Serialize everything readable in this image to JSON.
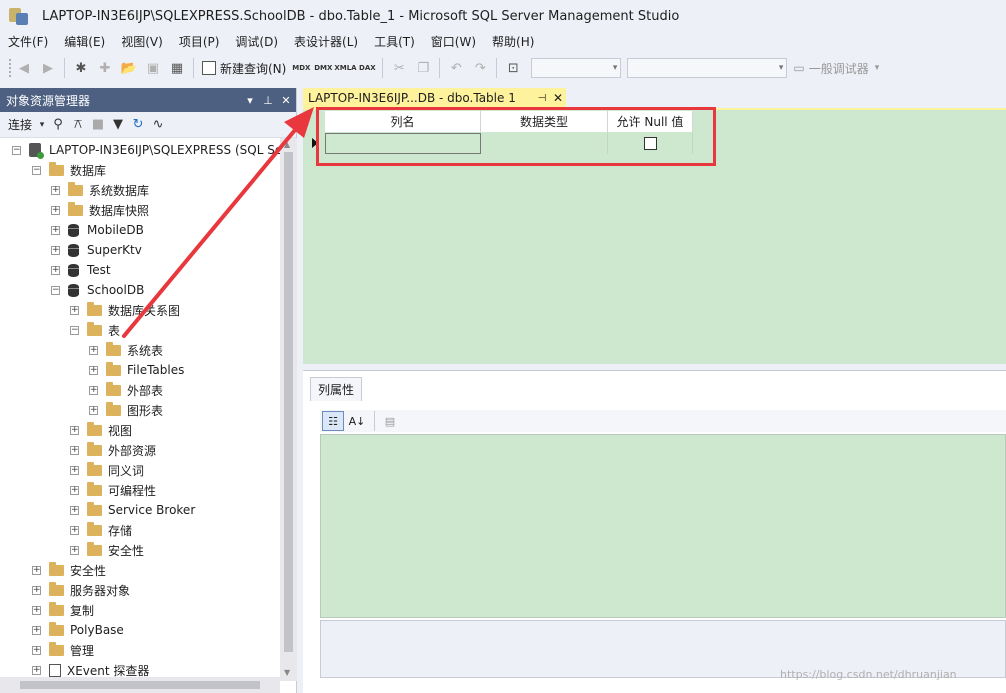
{
  "window": {
    "title": "LAPTOP-IN3E6IJP\\SQLEXPRESS.SchoolDB - dbo.Table_1 - Microsoft SQL Server Management Studio"
  },
  "menu": [
    "文件(F)",
    "编辑(E)",
    "视图(V)",
    "项目(P)",
    "调试(D)",
    "表设计器(L)",
    "工具(T)",
    "窗口(W)",
    "帮助(H)"
  ],
  "toolbar": {
    "new_query": "新建查询(N)",
    "mdx": "MDX",
    "dmx": "DMX",
    "xmla": "XMLA",
    "dax": "DAX",
    "debugger": "一般调试器"
  },
  "object_explorer": {
    "title": "对象资源管理器",
    "connect": "连接",
    "tree": [
      {
        "label": "LAPTOP-IN3E6IJP\\SQLEXPRESS (SQL Se",
        "icon": "server",
        "expander": "−"
      },
      {
        "label": "数据库",
        "icon": "folder",
        "expander": "−"
      },
      {
        "label": "系统数据库",
        "icon": "folder",
        "expander": "+"
      },
      {
        "label": "数据库快照",
        "icon": "folder",
        "expander": "+"
      },
      {
        "label": "MobileDB",
        "icon": "db",
        "expander": "+"
      },
      {
        "label": "SuperKtv",
        "icon": "db",
        "expander": "+"
      },
      {
        "label": "Test",
        "icon": "db",
        "expander": "+"
      },
      {
        "label": "SchoolDB",
        "icon": "db",
        "expander": "−"
      },
      {
        "label": "数据库关系图",
        "icon": "folder",
        "expander": "+"
      },
      {
        "label": "表",
        "icon": "folder",
        "expander": "−"
      },
      {
        "label": "系统表",
        "icon": "folder",
        "expander": "+"
      },
      {
        "label": "FileTables",
        "icon": "folder",
        "expander": "+"
      },
      {
        "label": "外部表",
        "icon": "folder",
        "expander": "+"
      },
      {
        "label": "图形表",
        "icon": "folder",
        "expander": "+"
      },
      {
        "label": "视图",
        "icon": "folder",
        "expander": "+"
      },
      {
        "label": "外部资源",
        "icon": "folder",
        "expander": "+"
      },
      {
        "label": "同义词",
        "icon": "folder",
        "expander": "+"
      },
      {
        "label": "可编程性",
        "icon": "folder",
        "expander": "+"
      },
      {
        "label": "Service Broker",
        "icon": "folder",
        "expander": "+"
      },
      {
        "label": "存储",
        "icon": "folder",
        "expander": "+"
      },
      {
        "label": "安全性",
        "icon": "folder",
        "expander": "+"
      },
      {
        "label": "安全性",
        "icon": "folder",
        "expander": "+"
      },
      {
        "label": "服务器对象",
        "icon": "folder",
        "expander": "+"
      },
      {
        "label": "复制",
        "icon": "folder",
        "expander": "+"
      },
      {
        "label": "PolyBase",
        "icon": "folder",
        "expander": "+"
      },
      {
        "label": "管理",
        "icon": "folder",
        "expander": "+"
      },
      {
        "label": "XEvent 探查器",
        "icon": "xe",
        "expander": "+"
      }
    ]
  },
  "document_tab": {
    "label": "LAPTOP-IN3E6IJP...DB - dbo.Table 1"
  },
  "designer": {
    "columns": [
      "列名",
      "数据类型",
      "允许 Null 值"
    ],
    "row": {
      "name": "",
      "type": "",
      "allow_null": false
    }
  },
  "properties": {
    "tab": "列属性"
  },
  "watermark": "https://blog.csdn.net/dhruanjian",
  "colors": {
    "accent": "#4d6082",
    "tab_yellow": "#fff29d",
    "grid_green": "#cde8cf",
    "annotation_red": "#e8383d"
  }
}
